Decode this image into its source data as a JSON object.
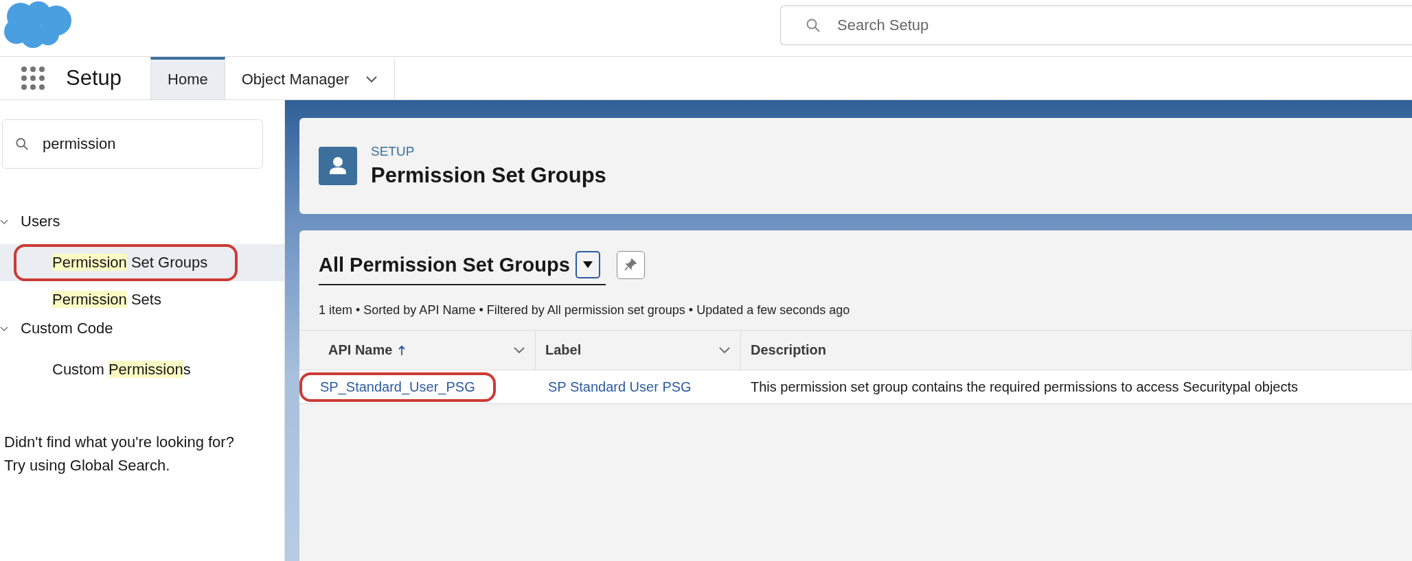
{
  "global_search": {
    "placeholder": "Search Setup"
  },
  "nav": {
    "app_name": "Setup",
    "tabs": [
      {
        "label": "Home",
        "selected": true,
        "has_menu": false
      },
      {
        "label": "Object Manager",
        "selected": false,
        "has_menu": true
      }
    ]
  },
  "sidebar": {
    "search": {
      "value": "permission"
    },
    "groups": [
      {
        "label": "Users",
        "expanded": true,
        "children": [
          {
            "parts": [
              {
                "text": "Permission",
                "highlight": true
              },
              {
                "text": " Set Groups",
                "highlight": false
              }
            ],
            "selected": true,
            "annotated": true
          },
          {
            "parts": [
              {
                "text": "Permission",
                "highlight": true
              },
              {
                "text": " Sets",
                "highlight": false
              }
            ],
            "selected": false,
            "annotated": false
          }
        ]
      },
      {
        "label": "Custom Code",
        "expanded": true,
        "children": [
          {
            "parts": [
              {
                "text": "Custom ",
                "highlight": false
              },
              {
                "text": "Permission",
                "highlight": true
              },
              {
                "text": "s",
                "highlight": false
              }
            ],
            "selected": false,
            "annotated": false
          }
        ]
      }
    ],
    "help_lines": [
      "Didn't find what you're looking for?",
      "Try using Global Search."
    ]
  },
  "page_header": {
    "eyebrow": "SETUP",
    "title": "Permission Set Groups"
  },
  "list_view": {
    "title": "All Permission Set Groups",
    "info": "1 item • Sorted by API Name • Filtered by All permission set groups • Updated a few seconds ago",
    "columns": [
      {
        "label": "API Name",
        "sorted": true,
        "has_menu": true
      },
      {
        "label": "Label",
        "sorted": false,
        "has_menu": true
      },
      {
        "label": "Description",
        "sorted": false,
        "has_menu": false
      }
    ],
    "rows": [
      {
        "cells": [
          {
            "text": "SP_Standard_User_PSG",
            "kind": "link",
            "annotated": true
          },
          {
            "text": "SP Standard User PSG",
            "kind": "link",
            "annotated": false
          },
          {
            "text": "This permission set group contains the required permissions to access Securitypal objects",
            "kind": "text",
            "annotated": false
          }
        ]
      }
    ]
  }
}
